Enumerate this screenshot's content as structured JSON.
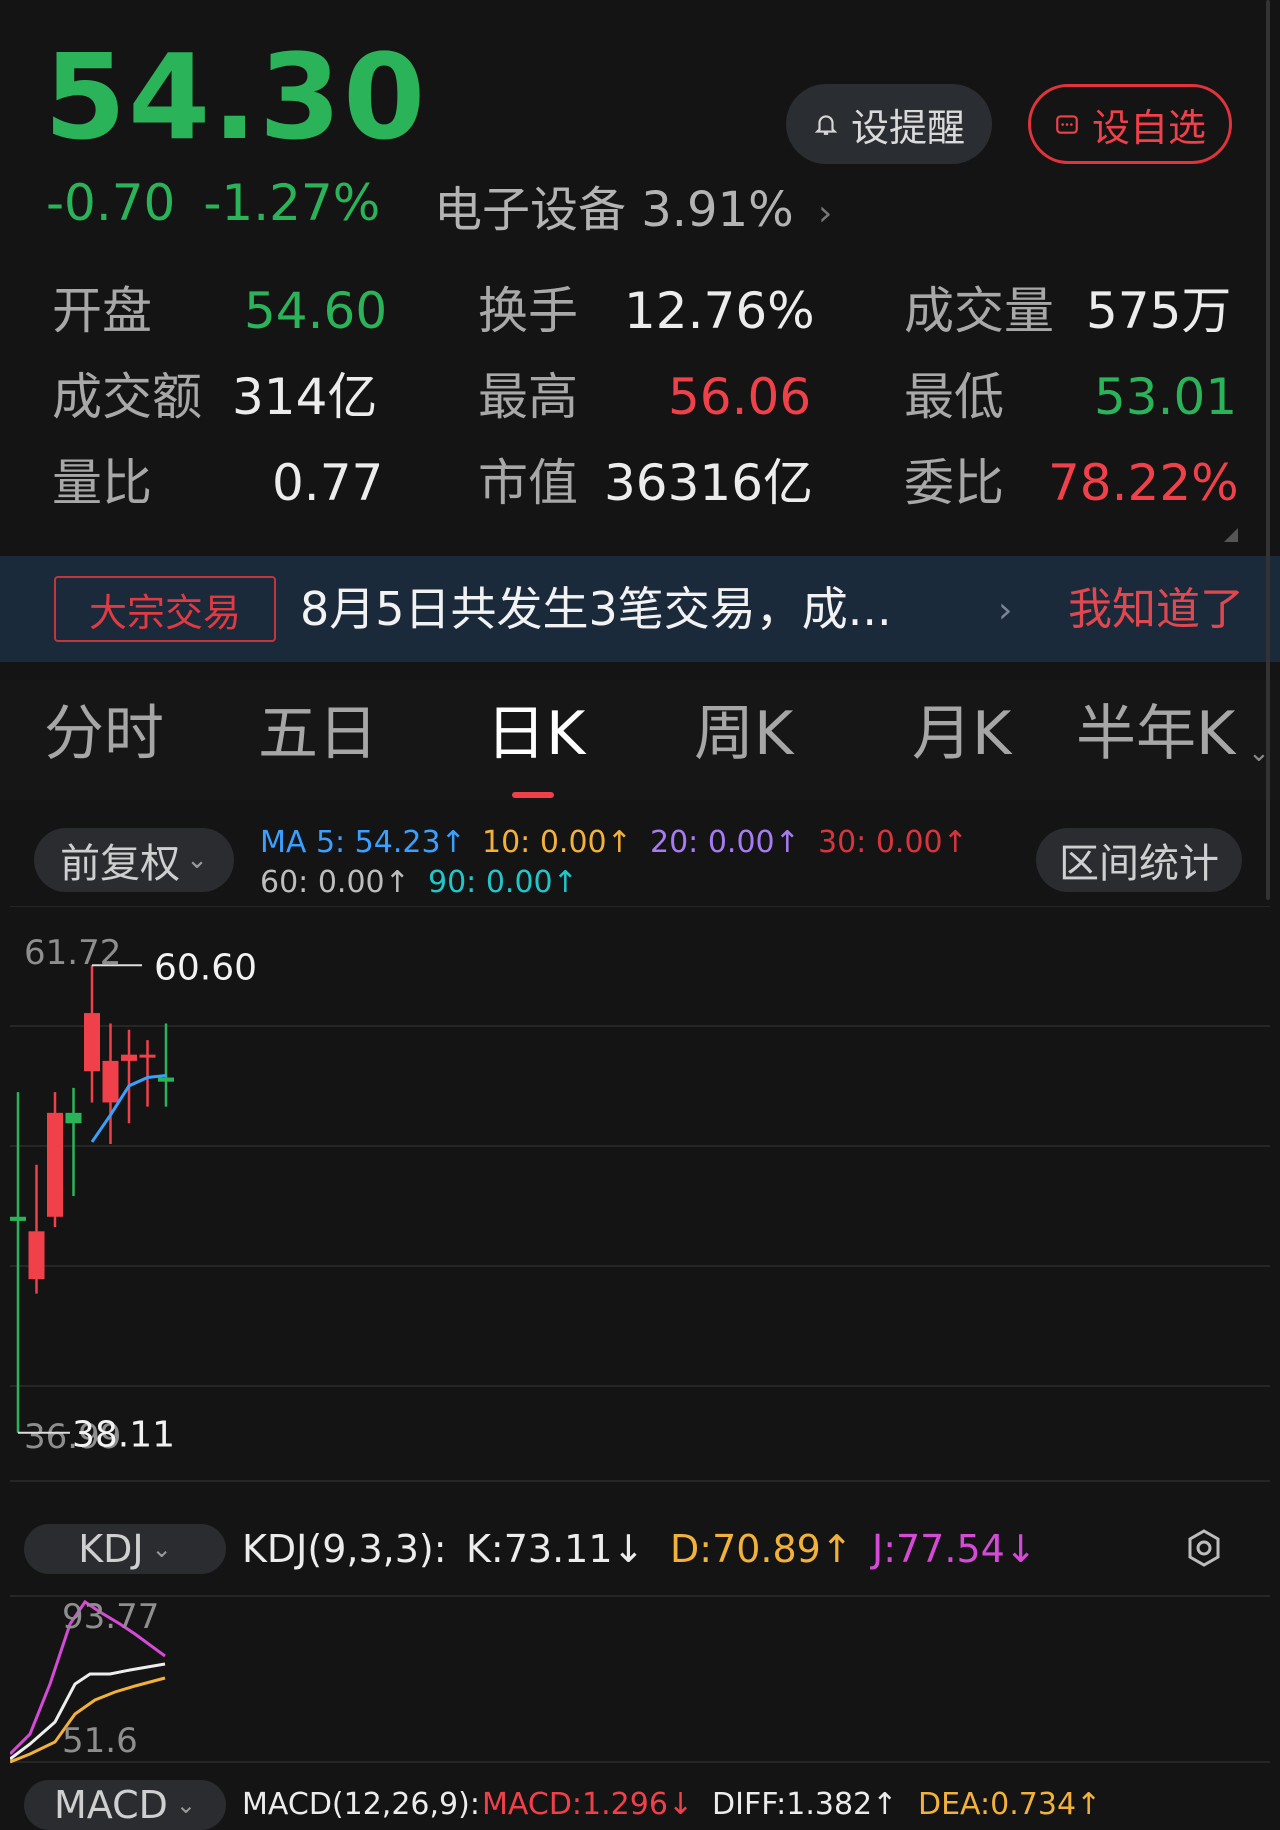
{
  "quote": {
    "price": "54.30",
    "change": "-0.70",
    "change_pct": "-1.27%",
    "sector": "电子设备 3.91%",
    "alert_label": "设提醒",
    "watch_label": "设自选",
    "stats": [
      {
        "label": "开盘",
        "value": "54.60",
        "color": "#2bb35a"
      },
      {
        "label": "换手",
        "value": "12.76%",
        "color": "#ececec"
      },
      {
        "label": "成交量",
        "value": "575万",
        "color": "#ececec"
      },
      {
        "label": "成交额",
        "value": "314亿",
        "color": "#ececec"
      },
      {
        "label": "最高",
        "value": "56.06",
        "color": "#f0404a"
      },
      {
        "label": "最低",
        "value": "53.01",
        "color": "#2bb35a"
      },
      {
        "label": "量比",
        "value": "0.77",
        "color": "#ececec"
      },
      {
        "label": "市值",
        "value": "36316亿",
        "color": "#ececec"
      },
      {
        "label": "委比",
        "value": "78.22%",
        "color": "#f0404a"
      }
    ]
  },
  "banner": {
    "tag": "大宗交易",
    "text": "8月5日共发生3笔交易，成...",
    "dismiss": "我知道了"
  },
  "tabs": [
    "分时",
    "五日",
    "日K",
    "周K",
    "月K",
    "半年K"
  ],
  "active_tab": "日K",
  "chart_header": {
    "adjust_label": "前复权",
    "range_label": "区间统计",
    "ma": [
      {
        "text": "MA 5: 54.23↑",
        "color": "#3aa0ff"
      },
      {
        "text": "10: 0.00↑",
        "color": "#f2b13b"
      },
      {
        "text": "20: 0.00↑",
        "color": "#a77bf3"
      },
      {
        "text": "30: 0.00↑",
        "color": "#d8343d"
      },
      {
        "text": "60: 0.00↑",
        "color": "#bdbdbd"
      },
      {
        "text": "90: 0.00↑",
        "color": "#22c6c9"
      }
    ]
  },
  "chart_data": {
    "type": "candlestick",
    "ylim": [
      36.99,
      61.72
    ],
    "axis_top_label": "61.72",
    "axis_bottom_label": "36.99",
    "max_marker": "60.60",
    "min_marker": "38.11",
    "candles": [
      {
        "open": 48.5,
        "close": 48.3,
        "high": 54.5,
        "low": 38.11
      },
      {
        "open": 45.5,
        "close": 47.8,
        "high": 51.0,
        "low": 44.8
      },
      {
        "open": 48.5,
        "close": 53.5,
        "high": 54.5,
        "low": 48.0
      },
      {
        "open": 53.5,
        "close": 53.0,
        "high": 54.7,
        "low": 49.5
      },
      {
        "open": 55.5,
        "close": 58.3,
        "high": 60.6,
        "low": 54.0
      },
      {
        "open": 54.0,
        "close": 56.0,
        "high": 57.8,
        "low": 52.0
      },
      {
        "open": 56.0,
        "close": 56.3,
        "high": 57.5,
        "low": 53.0
      },
      {
        "open": 56.2,
        "close": 56.3,
        "high": 57.0,
        "low": 53.8
      },
      {
        "open": 55.2,
        "close": 55.0,
        "high": 57.8,
        "low": 53.8
      }
    ],
    "ma5": [
      null,
      null,
      null,
      null,
      52.1,
      53.4,
      54.8,
      55.2,
      55.3
    ]
  },
  "kdj": {
    "button_label": "KDJ",
    "params": "KDJ(9,3,3):",
    "k": "K:73.11↓",
    "d": "D:70.89↑",
    "j": "J:77.54↓",
    "k_color": "#ececec",
    "d_color": "#f2b13b",
    "j_color": "#d64ad8",
    "top_label": "93.77",
    "bottom_label": "51.6"
  },
  "macd": {
    "button_label": "MACD",
    "params": "MACD(12,26,9):",
    "macd": "MACD:1.296↓",
    "dif": "DIFF:1.382↑",
    "dea": "DEA:0.734↑"
  }
}
